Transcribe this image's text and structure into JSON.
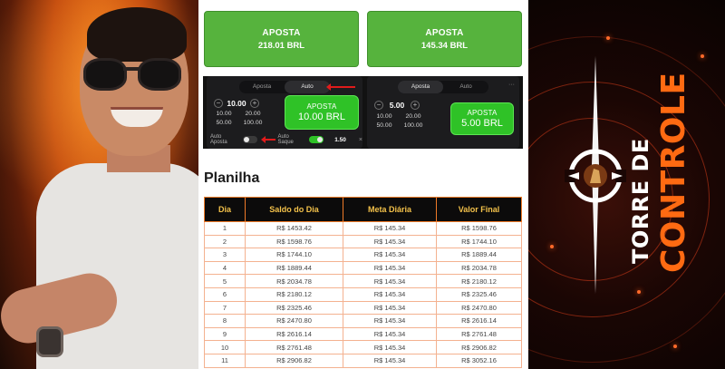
{
  "bet_buttons": [
    {
      "label": "APOSTA",
      "amount": "218.01 BRL"
    },
    {
      "label": "APOSTA",
      "amount": "145.34 BRL"
    }
  ],
  "game_panel_a": {
    "tabs": [
      "Aposta",
      "Auto"
    ],
    "active_tab": "Auto",
    "stake": "10.00",
    "quick_amounts": [
      "10.00",
      "20.00",
      "50.00",
      "100.00"
    ],
    "bet_label": "APOSTA",
    "bet_amount": "10.00 BRL",
    "auto_bet_label": "Auto Aposta",
    "auto_bet_on": false,
    "auto_cashout_label": "Auto Saque",
    "auto_cashout_on": true,
    "auto_cashout_value": "1.50",
    "clear_icon": "×"
  },
  "game_panel_b": {
    "tabs": [
      "Aposta",
      "Auto"
    ],
    "active_tab": "Aposta",
    "stake": "5.00",
    "quick_amounts": [
      "10.00",
      "20.00",
      "50.00",
      "100.00"
    ],
    "bet_label": "APOSTA",
    "bet_amount": "5.00 BRL",
    "menu_icon": "···"
  },
  "sheet": {
    "title": "Planilha",
    "headers": [
      "Dia",
      "Saldo do Dia",
      "Meta Diária",
      "Valor Final"
    ],
    "rows": [
      [
        "1",
        "R$ 1453.42",
        "R$ 145.34",
        "R$ 1598.76"
      ],
      [
        "2",
        "R$ 1598.76",
        "R$ 145.34",
        "R$ 1744.10"
      ],
      [
        "3",
        "R$ 1744.10",
        "R$ 145.34",
        "R$ 1889.44"
      ],
      [
        "4",
        "R$ 1889.44",
        "R$ 145.34",
        "R$ 2034.78"
      ],
      [
        "5",
        "R$ 2034.78",
        "R$ 145.34",
        "R$ 2180.12"
      ],
      [
        "6",
        "R$ 2180.12",
        "R$ 145.34",
        "R$ 2325.46"
      ],
      [
        "7",
        "R$ 2325.46",
        "R$ 145.34",
        "R$ 2470.80"
      ],
      [
        "8",
        "R$ 2470.80",
        "R$ 145.34",
        "R$ 2616.14"
      ],
      [
        "9",
        "R$ 2616.14",
        "R$ 145.34",
        "R$ 2761.48"
      ],
      [
        "10",
        "R$ 2761.48",
        "R$ 145.34",
        "R$ 2906.82"
      ],
      [
        "11",
        "R$ 2906.82",
        "R$ 145.34",
        "R$ 3052.16"
      ]
    ]
  },
  "logo": {
    "line1": "TORRE DE",
    "line2": "CONTROLE"
  },
  "colors": {
    "bet_green": "#56b33d",
    "game_green": "#2fc227",
    "table_header_bg": "#0c0b0b",
    "table_header_text": "#f3c14a",
    "table_border": "#ef7a28",
    "logo_orange": "#ff6a12",
    "arrow_red": "#e01b1b"
  },
  "icons": [
    "minus-icon",
    "plus-icon",
    "toggle-icon",
    "close-icon",
    "menu-dots-icon",
    "arrow-icon",
    "compass-emblem-icon"
  ]
}
